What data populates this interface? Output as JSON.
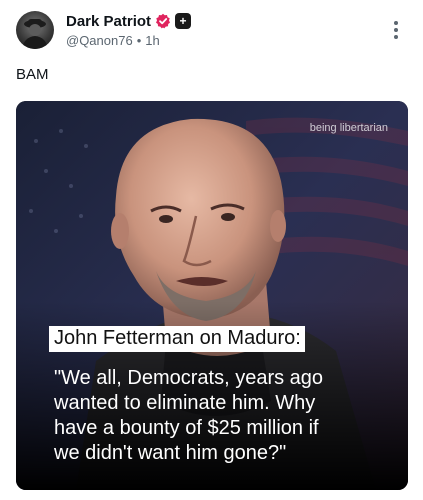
{
  "author": {
    "display_name": "Dark Patriot",
    "handle": "@Qanon76",
    "separator": "•",
    "time": "1h",
    "badges": [
      "verified-badge-icon",
      "plus-badge-icon"
    ],
    "plus_symbol": "+"
  },
  "post": {
    "text": "BAM"
  },
  "media": {
    "watermark": "being libertarian",
    "headline": "John Fetterman on Maduro:",
    "quote_lines": [
      "\"We all, Democrats, years ago",
      "wanted to eliminate him. Why",
      "have a bounty of $25 million if",
      "we didn't want him gone?\""
    ]
  },
  "colors": {
    "verified_badge": "#e0245e",
    "text_primary": "#0f1419",
    "text_secondary": "#5b6670"
  },
  "icons": {
    "more": "more-vertical-icon"
  }
}
